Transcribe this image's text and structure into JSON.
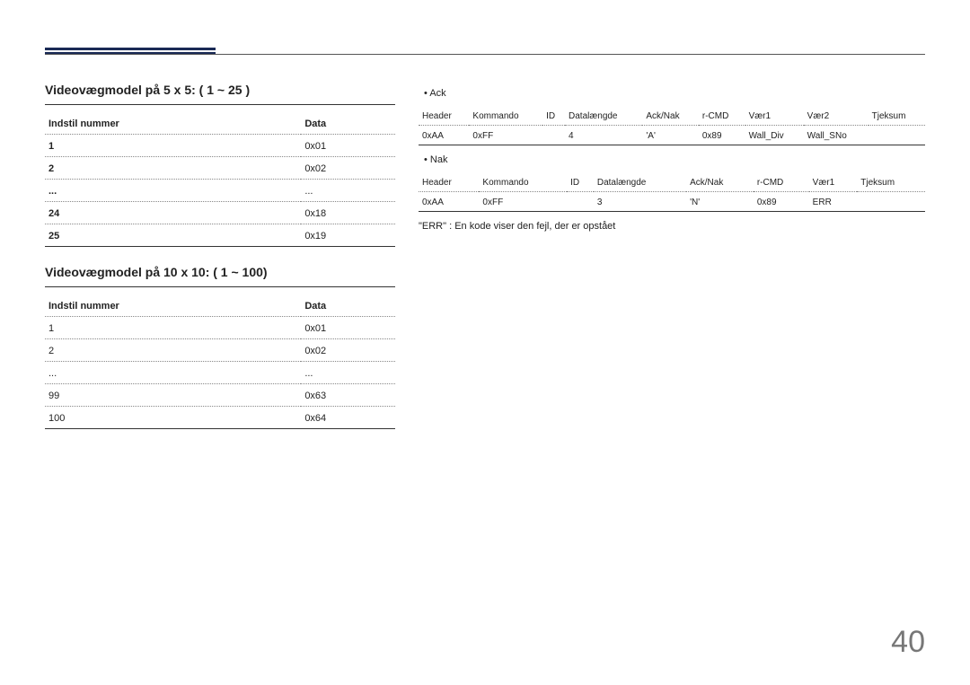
{
  "headings": {
    "h5x5": "Videovægmodel på 5 x 5: ( 1 ~ 25 )",
    "h10x10": "Videovægmodel på 10 x 10: ( 1 ~ 100)"
  },
  "table5x5": {
    "col1": "Indstil nummer",
    "col2": "Data",
    "rows": [
      {
        "a": "1",
        "b": "0x01"
      },
      {
        "a": "2",
        "b": "0x02"
      },
      {
        "a": "...",
        "b": "..."
      },
      {
        "a": "24",
        "b": "0x18"
      },
      {
        "a": "25",
        "b": "0x19"
      }
    ]
  },
  "table10x10": {
    "col1": "Indstil nummer",
    "col2": "Data",
    "rows": [
      {
        "a": "1",
        "b": "0x01"
      },
      {
        "a": "2",
        "b": "0x02"
      },
      {
        "a": "...",
        "b": "..."
      },
      {
        "a": "99",
        "b": "0x63"
      },
      {
        "a": "100",
        "b": "0x64"
      }
    ]
  },
  "right": {
    "ack": "Ack",
    "nak": "Nak",
    "ack_header": [
      "Header",
      "Kommando",
      "ID",
      "Datalængde",
      "Ack/Nak",
      "r-CMD",
      "Vær1",
      "Vær2",
      "Tjeksum"
    ],
    "ack_row": [
      "0xAA",
      "0xFF",
      "",
      "4",
      "'A'",
      "0x89",
      "Wall_Div",
      "Wall_SNo",
      ""
    ],
    "nak_header": [
      "Header",
      "Kommando",
      "ID",
      "Datalængde",
      "Ack/Nak",
      "r-CMD",
      "Vær1",
      "Tjeksum"
    ],
    "nak_row": [
      "0xAA",
      "0xFF",
      "",
      "3",
      "'N'",
      "0x89",
      "ERR",
      ""
    ],
    "err_note": "\"ERR\" : En kode viser den fejl, der er opstået"
  },
  "page_number": "40"
}
